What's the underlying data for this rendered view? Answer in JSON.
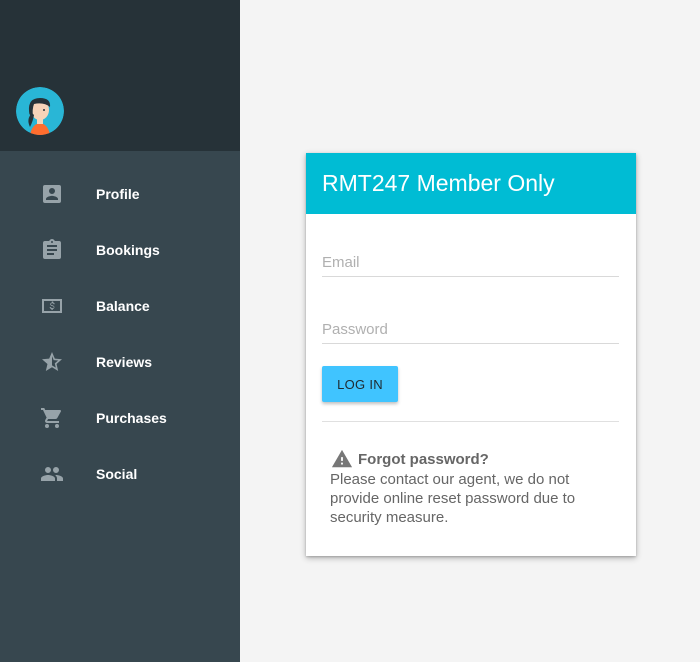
{
  "sidebar": {
    "avatar_icon": "woman-avatar-icon",
    "items": [
      {
        "label": "Profile",
        "icon": "account-box-icon"
      },
      {
        "label": "Bookings",
        "icon": "clipboard-icon"
      },
      {
        "label": "Balance",
        "icon": "money-icon"
      },
      {
        "label": "Reviews",
        "icon": "star-half-icon"
      },
      {
        "label": "Purchases",
        "icon": "cart-icon"
      },
      {
        "label": "Social",
        "icon": "people-icon"
      }
    ]
  },
  "login": {
    "title": "RMT247 Member Only",
    "email_placeholder": "Email",
    "password_placeholder": "Password",
    "submit_label": "LOG IN",
    "forgot_title": "Forgot password?",
    "forgot_text": "Please contact our agent, we do not provide online reset password due to security measure.",
    "warning_icon": "warning-icon"
  },
  "colors": {
    "sidebar_bg": "#37474f",
    "sidebar_header_bg": "#263238",
    "card_header_bg": "#00bcd4",
    "button_bg": "#40c4ff",
    "page_bg": "#f4f4f4"
  }
}
